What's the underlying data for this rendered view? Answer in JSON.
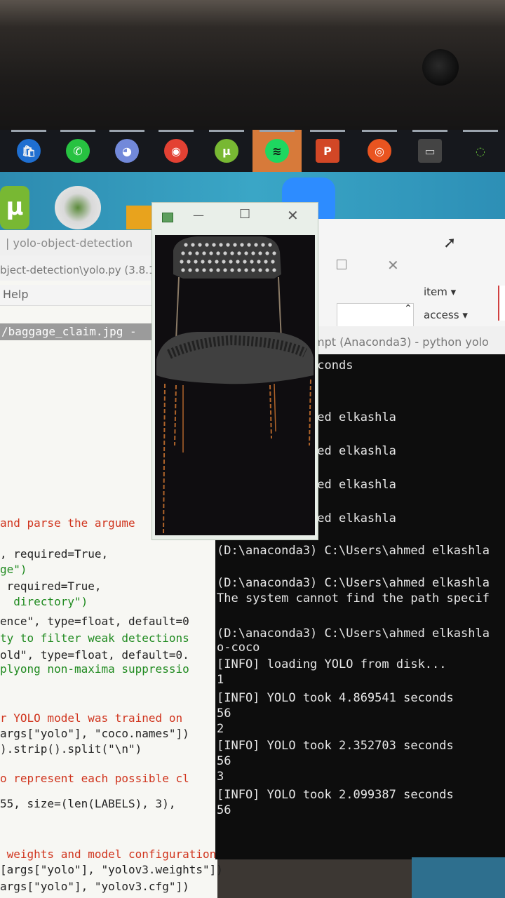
{
  "taskbar": {
    "apps": [
      {
        "name": "store-icon",
        "glyph": "🛍",
        "color": "#f2f2f2",
        "bg": "#1f6fd1"
      },
      {
        "name": "whatsapp-icon",
        "glyph": "✆",
        "color": "#ffffff",
        "bg": "#27c241"
      },
      {
        "name": "discord-icon",
        "glyph": "◕",
        "color": "#ffffff",
        "bg": "#7289da"
      },
      {
        "name": "chrome-icon",
        "glyph": "◉",
        "color": "#ffffff",
        "bg": "#e34133"
      },
      {
        "name": "utorrent-icon",
        "glyph": "µ",
        "color": "#ffffff",
        "bg": "#78b833"
      },
      {
        "name": "spotify-icon",
        "glyph": "≋",
        "color": "#111",
        "bg": "#1ed760"
      },
      {
        "name": "powerpoint-icon",
        "glyph": "P",
        "color": "#ffffff",
        "bg": "#d24726"
      },
      {
        "name": "ubuntu-icon",
        "glyph": "◎",
        "color": "#ffffff",
        "bg": "#e95420"
      },
      {
        "name": "cmd-icon",
        "glyph": "▭",
        "color": "#cccccc",
        "bg": "#444"
      },
      {
        "name": "circle-app-icon",
        "glyph": "◌",
        "color": "#67c23a",
        "bg": "#16181d"
      }
    ]
  },
  "idle": {
    "title": "| yolo-object-detection",
    "path": "bject-detection\\yolo.py (3.8.1",
    "menu": "Help",
    "tab": "/baggage_claim.jpg -",
    "lines": [
      {
        "t": "and parse the argume",
        "cls": "c-com"
      },
      {
        "t": ", required=True,",
        "cls": ""
      },
      {
        "t": "ge\")",
        "cls": "c-str"
      },
      {
        "t": " required=True,",
        "cls": ""
      },
      {
        "t": "  directory\")",
        "cls": "c-str"
      },
      {
        "t": "ence\", type=float, default=0",
        "cls": ""
      },
      {
        "t": "ty to filter weak detections",
        "cls": "c-str"
      },
      {
        "t": "old\", type=float, default=0.",
        "cls": ""
      },
      {
        "t": "plyong non-maxima suppressio",
        "cls": "c-str"
      },
      {
        "t": "r YOLO model was trained on",
        "cls": "c-com"
      },
      {
        "t": "args[\"yolo\"], \"coco.names\"])",
        "cls": ""
      },
      {
        "t": ").strip().split(\"\\n\")",
        "cls": ""
      },
      {
        "t": "o represent each possible cl",
        "cls": "c-com"
      },
      {
        "t": "55, size=(len(LABELS), 3),",
        "cls": ""
      },
      {
        "t": " weights and model configuration",
        "cls": "c-com"
      },
      {
        "t": "[args[\"yolo\"], \"yolov3.weights\"])",
        "cls": ""
      },
      {
        "t": "args[\"yolo\"], \"yolov3.cfg\"])",
        "cls": ""
      }
    ]
  },
  "explorer": {
    "item1": "item ▾",
    "item2": "access ▾"
  },
  "cmd": {
    "title": "mpt (Anaconda3) - python  yolo",
    "lines": [
      "ok 1.095073 seconds",
      "",
      "",
      "  C:\\Users\\ahmed elkashla",
      "",
      "  C:\\Users\\ahmed elkashla",
      "",
      "  C:\\Users\\ahmed elkashla",
      "",
      "  C:\\Users\\ahmed elkashla",
      "",
      "(D:\\anaconda3) C:\\Users\\ahmed elkashla",
      "",
      "(D:\\anaconda3) C:\\Users\\ahmed elkashla",
      "The system cannot find the path specif",
      "",
      "(D:\\anaconda3) C:\\Users\\ahmed elkashla",
      "o-coco",
      "[INFO] loading YOLO from disk...",
      "1",
      "[INFO] YOLO took 4.869541 seconds",
      "56",
      "2",
      "[INFO] YOLO took 2.352703 seconds",
      "56",
      "3",
      "[INFO] YOLO took 2.099387 seconds",
      "56"
    ]
  },
  "chairwin": {
    "min": "—",
    "max": "☐",
    "close": "✕"
  }
}
